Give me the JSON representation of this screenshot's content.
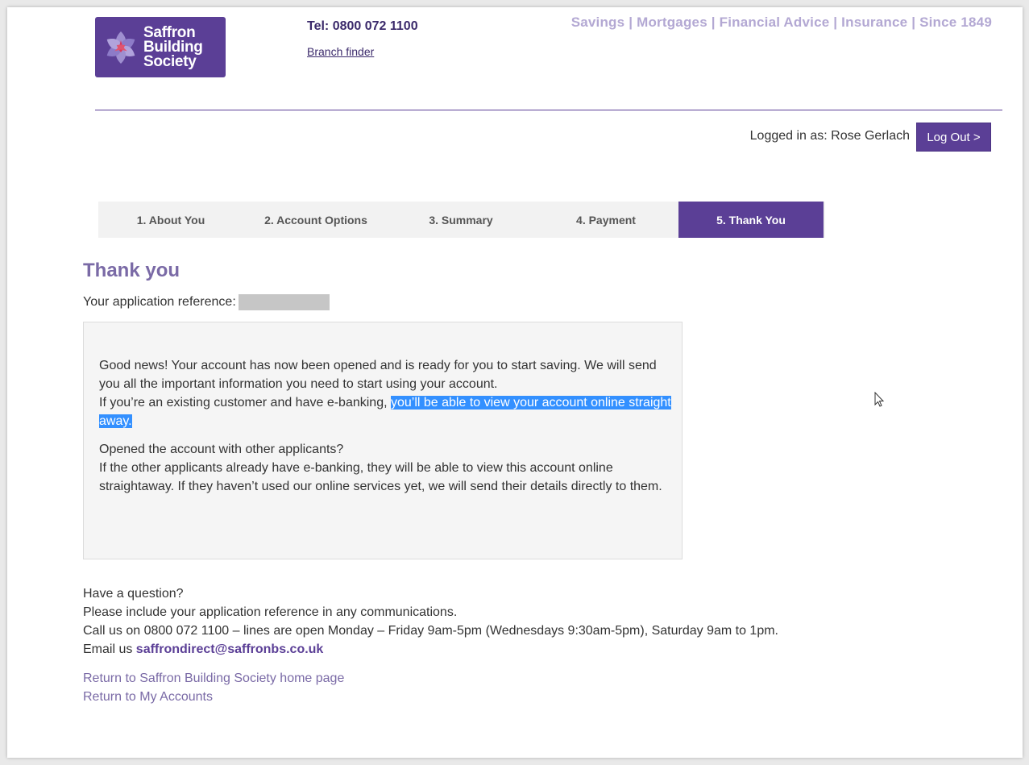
{
  "brand": {
    "logo_lines": [
      "Saffron",
      "Building",
      "Society"
    ],
    "tel": "Tel: 0800 072 1100",
    "branch_finder": "Branch finder",
    "tagline": "Savings | Mortgages | Financial Advice | Insurance | Since 1849",
    "colors": {
      "primary": "#5b3f96",
      "tagline": "#b3a8d3",
      "link": "#7a6aa6",
      "selection": "#3390ff"
    }
  },
  "session": {
    "logged_in_label": "Logged in as: Rose Gerlach",
    "logout_label": "Log Out >"
  },
  "steps": [
    {
      "label": "1. About You"
    },
    {
      "label": "2. Account Options"
    },
    {
      "label": "3. Summary"
    },
    {
      "label": "4. Payment"
    },
    {
      "label": "5. Thank You",
      "active": true
    }
  ],
  "main": {
    "heading": "Thank you",
    "reference_label": "Your application reference:"
  },
  "info": {
    "p1_line1": "Good news! Your account has now been opened and is ready for you to start saving. We will send you all the important information you need to start using your account.",
    "p1_line2_plain": "If you’re an existing customer and have e-banking, ",
    "p1_line2_selected": "you’ll be able to view your account online straight away.",
    "p2_title": "Opened the account with other applicants?",
    "p2_body": "If the other applicants already have e-banking, they will be able to view this account online straightaway. If they haven’t used our online services yet, we will send their details directly to them."
  },
  "help": {
    "q": "Have a question?",
    "line1": "Please include your application reference in any communications.",
    "line2": "Call us on 0800 072 1100 – lines are open Monday – Friday 9am-5pm (Wednesdays 9:30am-5pm), Saturday 9am to 1pm.",
    "email_prefix": "Email us ",
    "email": "saffrondirect@saffronbs.co.uk"
  },
  "links": {
    "home": "Return to Saffron Building Society home page",
    "accounts": "Return to My Accounts"
  }
}
